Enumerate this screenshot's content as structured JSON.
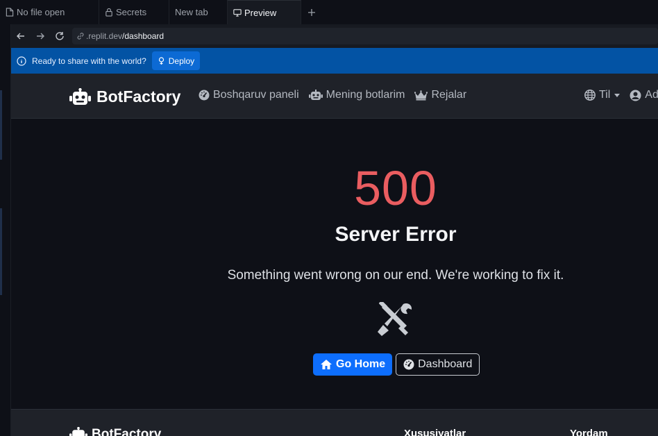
{
  "tabs": [
    {
      "label": "No file open",
      "icon": "file-icon"
    },
    {
      "label": "Secrets",
      "icon": "lock-icon"
    },
    {
      "label": "New tab"
    },
    {
      "label": "Preview",
      "icon": "monitor-icon",
      "active": true
    }
  ],
  "address": {
    "host": ".replit.dev",
    "path": "/dashboard"
  },
  "banner": {
    "message": "Ready to share with the world?",
    "deploy_label": "Deploy"
  },
  "site_nav": {
    "brand": "BotFactory",
    "links": [
      {
        "label": "Boshqaruv paneli",
        "icon": "dashboard-gauge-icon"
      },
      {
        "label": "Mening botlarim",
        "icon": "robot-icon"
      },
      {
        "label": "Rejalar",
        "icon": "crown-icon"
      }
    ],
    "language_label": "Til",
    "account_label": "Ad"
  },
  "error": {
    "code": "500",
    "title": "Server Error",
    "message": "Something went wrong on our end. We're working to fix it.",
    "home_label": "Go Home",
    "dashboard_label": "Dashboard"
  },
  "footer": {
    "brand": "BotFactory",
    "col1": "Xususiyatlar",
    "col2": "Yordam"
  },
  "colors": {
    "error_code": "#ea5d60",
    "primary": "#0d6efd",
    "banner": "#0353a4"
  }
}
